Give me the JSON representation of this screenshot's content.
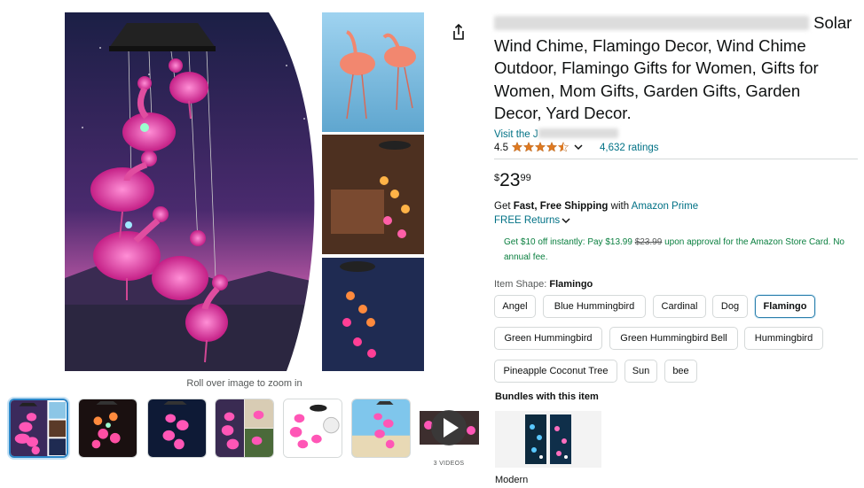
{
  "gallery": {
    "zoom_hint": "Roll over image to zoom in",
    "videos_label": "3 VIDEOS",
    "thumbnails": [
      {
        "kind": "image",
        "selected": true
      },
      {
        "kind": "image",
        "selected": false
      },
      {
        "kind": "image",
        "selected": false
      },
      {
        "kind": "image",
        "selected": false
      },
      {
        "kind": "image",
        "selected": false
      },
      {
        "kind": "image",
        "selected": false
      },
      {
        "kind": "video",
        "selected": false
      }
    ],
    "share_icon": "share-icon"
  },
  "product": {
    "title": "Solar Wind Chime, Flamingo Decor, Wind Chime Outdoor, Flamingo Gifts for Women, Gifts for Women, Mom Gifts, Garden Gifts, Garden Decor, Yard Decor.",
    "title_visible_lines": [
      "Solar",
      "Wind Chime, Flamingo Decor, Wind Chime",
      "Outdoor, Flamingo Gifts for Women, Gifts for",
      "Women, Mom Gifts, Garden Gifts, Garden",
      "Decor, Yard Decor."
    ],
    "store_link_prefix": "Visit the J",
    "rating_value": "4.5",
    "rating_stars": 4.5,
    "ratings_count": "4,632 ratings",
    "price": {
      "symbol": "$",
      "whole": "23",
      "fraction": "99"
    },
    "shipping": {
      "prefix": "Get ",
      "bold": "Fast, Free Shipping",
      "middle": " with ",
      "link": "Amazon Prime"
    },
    "returns": "FREE Returns",
    "offer": {
      "text_1": "Get $10 off instantly: Pay ",
      "new_price": "$13.99",
      "old_price": "$23.99",
      "text_2": " upon approval for the Amazon Store Card. No annual fee."
    },
    "shape_label": "Item Shape:",
    "shape_selected": "Flamingo"
  },
  "options": [
    {
      "label": "Angel",
      "selected": false
    },
    {
      "label": "Blue Hummingbird",
      "selected": false
    },
    {
      "label": "Cardinal",
      "selected": false
    },
    {
      "label": "Dog",
      "selected": false
    },
    {
      "label": "Flamingo",
      "selected": true
    },
    {
      "label": "Green Hummingbird",
      "selected": false
    },
    {
      "label": "Green Hummingbird Bell",
      "selected": false
    },
    {
      "label": "Hummingbird",
      "selected": false
    },
    {
      "label": "Pineapple Coconut Tree",
      "selected": false
    },
    {
      "label": "Sun",
      "selected": false
    },
    {
      "label": "bee",
      "selected": false
    }
  ],
  "bundles": {
    "title": "Bundles with this item",
    "items": [
      {
        "name": "Modern"
      }
    ]
  },
  "colors": {
    "link": "#007185",
    "star": "#de7921",
    "offer_green": "#0a7f3f",
    "selected_border": "#2a7eab"
  }
}
